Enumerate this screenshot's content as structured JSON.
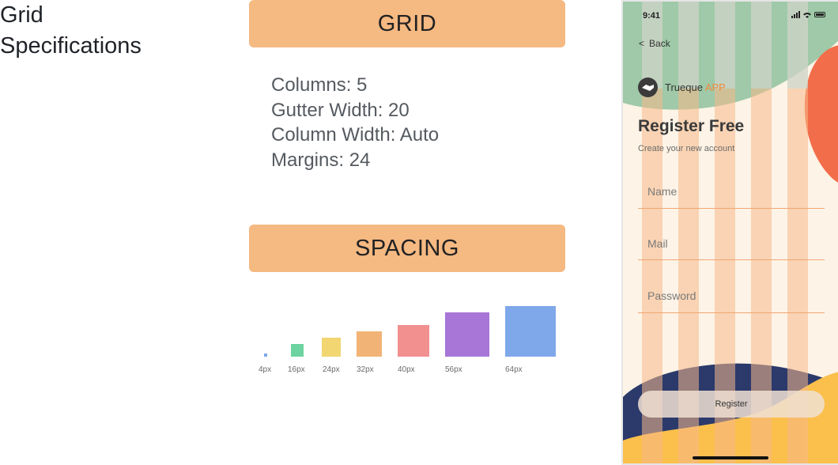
{
  "page_title": "Grid Specifications",
  "grid": {
    "header": "GRID",
    "specs": [
      "Columns: 5",
      "Gutter Width: 20",
      "Column Width: Auto",
      "Margins: 24"
    ]
  },
  "spacing": {
    "header": "SPACING",
    "swatches": [
      {
        "label": "4px",
        "color": "#7fa8e8"
      },
      {
        "label": "16px",
        "color": "#6dd3a0"
      },
      {
        "label": "24px",
        "color": "#f1d672"
      },
      {
        "label": "32px",
        "color": "#f2b376"
      },
      {
        "label": "40px",
        "color": "#f28f8f"
      },
      {
        "label": "56px",
        "color": "#a776d6"
      },
      {
        "label": "64px",
        "color": "#7fa8ea"
      }
    ]
  },
  "phone": {
    "status_time": "9:41",
    "back_label": "Back",
    "app_name": "Trueque",
    "app_name_accent": "APP",
    "title": "Register Free",
    "subtitle": "Create your new account",
    "fields": [
      {
        "placeholder": "Name"
      },
      {
        "placeholder": "Mail"
      },
      {
        "placeholder": "Password"
      }
    ],
    "register_label": "Register",
    "colors": {
      "column_overlay": "#f7b98a",
      "accent_orange": "#f08a3c",
      "teal_blob": "#9dc7b0",
      "navy_blob": "#2b3a6b",
      "yellow_blob": "#fbbf4c",
      "red_blob": "#f26d4a"
    }
  }
}
